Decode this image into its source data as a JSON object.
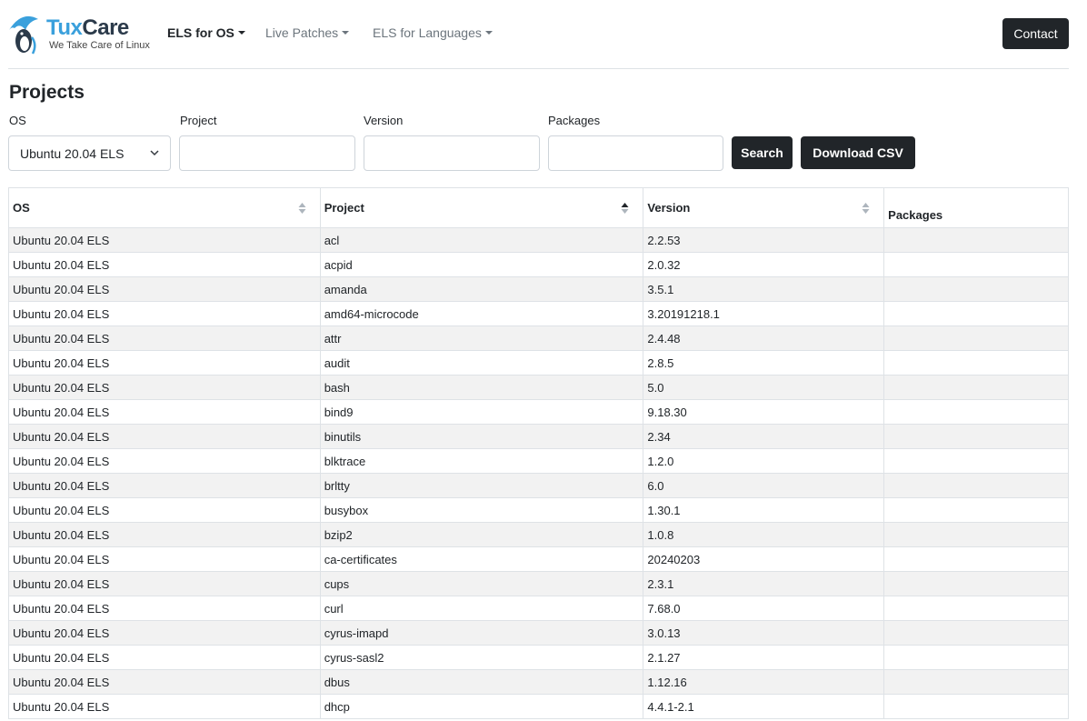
{
  "brand": {
    "name_part1": "Tux",
    "name_part2": "Care",
    "tagline": "We Take Care of Linux"
  },
  "nav": {
    "items": [
      {
        "label": "ELS for OS",
        "active": true
      },
      {
        "label": "Live Patches",
        "active": false
      },
      {
        "label": "ELS for Languages",
        "active": false
      }
    ],
    "contact_label": "Contact"
  },
  "page": {
    "title": "Projects"
  },
  "filters": {
    "os_label": "OS",
    "os_value": "Ubuntu 20.04 ELS",
    "project_label": "Project",
    "project_value": "",
    "version_label": "Version",
    "version_value": "",
    "packages_label": "Packages",
    "packages_value": "",
    "search_label": "Search",
    "download_label": "Download CSV"
  },
  "table": {
    "columns": [
      "OS",
      "Project",
      "Version",
      "Packages"
    ],
    "sorted_column": "Project",
    "rows": [
      [
        "Ubuntu 20.04 ELS",
        "acl",
        "2.2.53",
        ""
      ],
      [
        "Ubuntu 20.04 ELS",
        "acpid",
        "2.0.32",
        ""
      ],
      [
        "Ubuntu 20.04 ELS",
        "amanda",
        "3.5.1",
        ""
      ],
      [
        "Ubuntu 20.04 ELS",
        "amd64-microcode",
        "3.20191218.1",
        ""
      ],
      [
        "Ubuntu 20.04 ELS",
        "attr",
        "2.4.48",
        ""
      ],
      [
        "Ubuntu 20.04 ELS",
        "audit",
        "2.8.5",
        ""
      ],
      [
        "Ubuntu 20.04 ELS",
        "bash",
        "5.0",
        ""
      ],
      [
        "Ubuntu 20.04 ELS",
        "bind9",
        "9.18.30",
        ""
      ],
      [
        "Ubuntu 20.04 ELS",
        "binutils",
        "2.34",
        ""
      ],
      [
        "Ubuntu 20.04 ELS",
        "blktrace",
        "1.2.0",
        ""
      ],
      [
        "Ubuntu 20.04 ELS",
        "brltty",
        "6.0",
        ""
      ],
      [
        "Ubuntu 20.04 ELS",
        "busybox",
        "1.30.1",
        ""
      ],
      [
        "Ubuntu 20.04 ELS",
        "bzip2",
        "1.0.8",
        ""
      ],
      [
        "Ubuntu 20.04 ELS",
        "ca-certificates",
        "20240203",
        ""
      ],
      [
        "Ubuntu 20.04 ELS",
        "cups",
        "2.3.1",
        ""
      ],
      [
        "Ubuntu 20.04 ELS",
        "curl",
        "7.68.0",
        ""
      ],
      [
        "Ubuntu 20.04 ELS",
        "cyrus-imapd",
        "3.0.13",
        ""
      ],
      [
        "Ubuntu 20.04 ELS",
        "cyrus-sasl2",
        "2.1.27",
        ""
      ],
      [
        "Ubuntu 20.04 ELS",
        "dbus",
        "1.12.16",
        ""
      ],
      [
        "Ubuntu 20.04 ELS",
        "dhcp",
        "4.4.1-2.1",
        ""
      ]
    ]
  },
  "colors": {
    "accent": "#3aa0dc",
    "dark_button": "#212529",
    "stripe": "#f2f2f2",
    "border": "#dee2e6"
  },
  "icons": {
    "logo": "penguin-umbrella-icon",
    "sort": "sort-arrows-icon",
    "select_chevron": "chevron-down-icon"
  }
}
